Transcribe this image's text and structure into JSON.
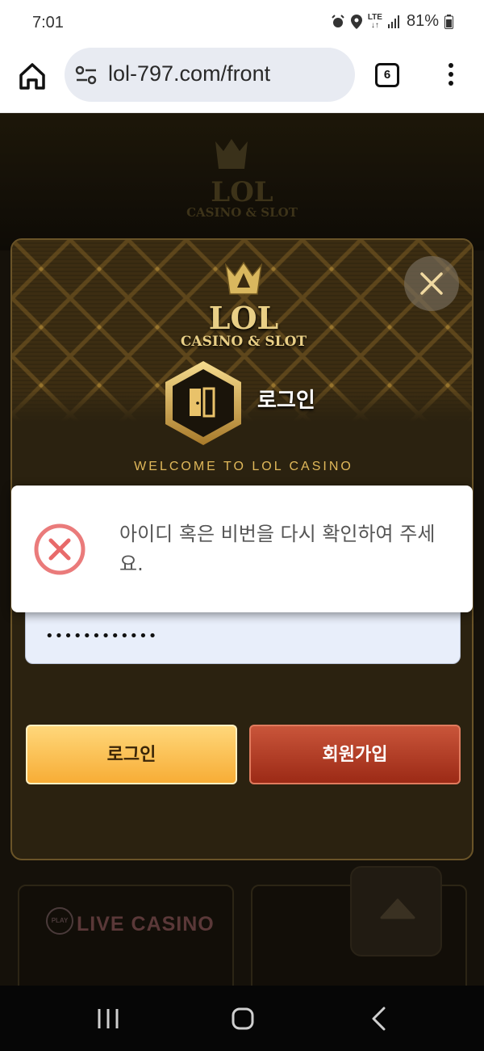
{
  "status_bar": {
    "time": "7:01",
    "network": "LTE",
    "battery": "81%"
  },
  "browser": {
    "url": "lol-797.com/front",
    "tab_count": "6"
  },
  "background_page": {
    "logo_main": "LOL",
    "logo_sub": "CASINO & SLOT",
    "live_casino_label": "LIVE CASINO",
    "play_badge": "PLAY"
  },
  "login_modal": {
    "logo_main": "LOL",
    "logo_sub": "CASINO & SLOT",
    "title": "로그인",
    "welcome": "WELCOME TO LOL CASINO",
    "password_value": "••••••••••••",
    "login_button": "로그인",
    "signup_button": "회원가입"
  },
  "alert": {
    "message": "아이디 혹은 비번을 다시 확인하여 주세요.",
    "icon": "error-x-circle-icon"
  },
  "colors": {
    "gold": "#e0b85a",
    "login_button": "#f7ad36",
    "signup_button": "#9c2a16",
    "error_red": "#ea7b7b"
  }
}
